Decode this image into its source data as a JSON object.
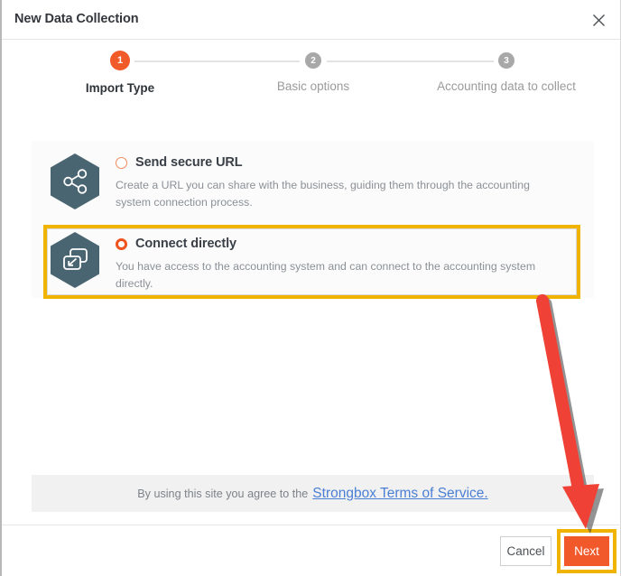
{
  "window": {
    "title": "New Data Collection",
    "close_icon": "close-x-icon"
  },
  "stepper": {
    "steps": [
      {
        "number": "1",
        "label": "Import Type",
        "state": "active"
      },
      {
        "number": "2",
        "label": "Basic options",
        "state": "inactive"
      },
      {
        "number": "3",
        "label": "Accounting data to collect",
        "state": "inactive"
      }
    ]
  },
  "options": [
    {
      "icon": "share-nodes-hexagon-icon",
      "title": "Send secure URL",
      "description": "Create a URL you can share with the business, guiding them through the accounting system connection process.",
      "selected": false
    },
    {
      "icon": "connect-windows-hexagon-icon",
      "title": "Connect directly",
      "description": "You have access to the accounting system and can connect to the accounting system directly.",
      "selected": true
    }
  ],
  "terms": {
    "text": "By using this site you agree to the",
    "link_label": "Strongbox Terms of Service."
  },
  "footer": {
    "cancel_label": "Cancel",
    "next_label": "Next"
  },
  "annotations": {
    "arrow": "red-arrow-annotation",
    "highlight_option": "yellow-highlight-connect-directly",
    "highlight_next": "yellow-highlight-next-button"
  },
  "colors": {
    "accent_orange": "#f1592a",
    "step_active": "#f15a29",
    "step_inactive": "#a8a8a8",
    "hexagon": "#4a6572",
    "link_blue": "#4a7fd4",
    "annotation_yellow": "#f0b400",
    "annotation_red": "#ef4136"
  }
}
